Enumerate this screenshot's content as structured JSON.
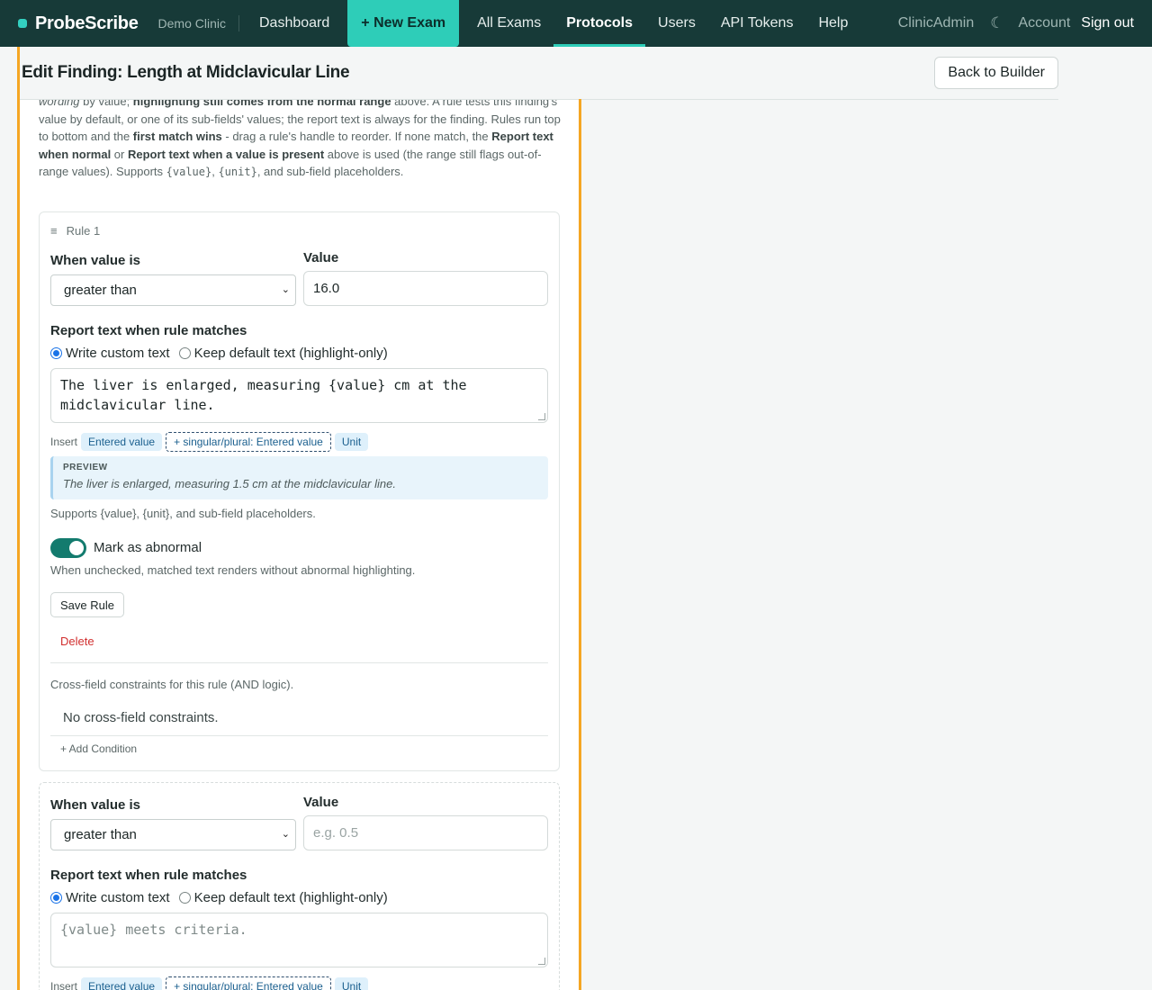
{
  "nav": {
    "brand": "ProbeScribe",
    "clinic": "Demo Clinic",
    "links": [
      "Dashboard",
      "+ New Exam",
      "All Exams",
      "Protocols",
      "Users",
      "API Tokens",
      "Help"
    ],
    "user": "ClinicAdmin",
    "theme_icon": "☾",
    "account": "Account",
    "sign_out": "Sign out"
  },
  "header": {
    "title": "Edit Finding: Length at Midclavicular Line",
    "back_button": "Back to Builder"
  },
  "intro": {
    "p1": "wording",
    "p2": " by value; ",
    "p3": "highlighting still comes from the normal range",
    "p4": " above. A rule tests this finding's value by default, or one of its sub-fields' values; the report text is always for the finding. Rules run top to bottom and the ",
    "p5": "first match wins",
    "p6": " - drag a rule's handle to reorder. If none match, the ",
    "p7": "Report text when normal",
    "p8": " or ",
    "p9": "Report text when a value is present",
    "p10": " above is used (the range still flags out-of-range values). Supports ",
    "p11": "{value}",
    "p12": ", ",
    "p13": "{unit}",
    "p14": ", and sub-field placeholders."
  },
  "rules": [
    {
      "title": "Rule 1",
      "handle_icon": "≡",
      "when_label": "When value is",
      "operator": "greater than",
      "value_label": "Value",
      "value": "16.0",
      "report_label": "Report text when rule matches",
      "radio_custom": "Write custom text",
      "radio_default": "Keep default text (highlight-only)",
      "report_text": "The liver is enlarged, measuring {value} cm at the midclavicular line.",
      "insert_label": "Insert",
      "chips": [
        "Entered value",
        "+ singular/plural: Entered value",
        "Unit"
      ],
      "preview_label": "PREVIEW",
      "preview_text": "The liver is enlarged, measuring 1.5 cm at the midclavicular line.",
      "supports_text": "Supports {value}, {unit}, and sub-field placeholders.",
      "abnormal_label": "Mark as abnormal",
      "abnormal_on": true,
      "abnormal_help": "When unchecked, matched text renders without abnormal highlighting.",
      "save_button": "Save Rule",
      "delete_button": "Delete",
      "constraints_help": "Cross-field constraints for this rule (AND logic).",
      "no_constraints": "No cross-field constraints.",
      "add_condition": "+ Add Condition"
    }
  ],
  "new_rule": {
    "when_label": "When value is",
    "operator": "greater than",
    "value_label": "Value",
    "value_placeholder": "e.g. 0.5",
    "report_label": "Report text when rule matches",
    "radio_custom": "Write custom text",
    "radio_default": "Keep default text (highlight-only)",
    "report_placeholder": "{value} meets criteria.",
    "insert_label": "Insert",
    "chips": [
      "Entered value",
      "+ singular/plural: Entered value",
      "Unit"
    ]
  }
}
